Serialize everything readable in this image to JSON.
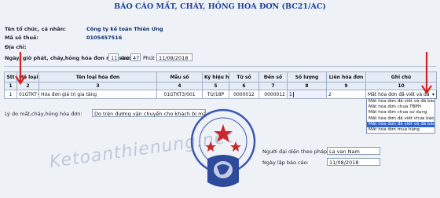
{
  "title": "BÁO CÁO MẤT, CHÁY, HỎNG HÓA ĐƠN (BC21/AC)",
  "org": {
    "name_label": "Tên tổ chức, cá nhân:",
    "name_value": "Công ty kế toán Thiên Ưng",
    "tax_label": "Mã số thuế:",
    "tax_value": "0105457516",
    "addr_label": "Địa chỉ:"
  },
  "incident": {
    "label": "Ngày, giờ phát, cháy,hỏng hóa đơn như sau:",
    "hour": "11",
    "hour_label": "Giờ",
    "minute": "47",
    "minute_label": "Phút",
    "date": "11/08/2018"
  },
  "table": {
    "headers": [
      "Stt",
      "Mã loại hóa đơn",
      "Tên loại hóa đơn",
      "Mẫu số",
      "Ký hiệu hóa đơn",
      "Từ số",
      "Đến số",
      "Số lượng",
      "Liên hóa đơn",
      "Ghi chú"
    ],
    "col_nums": [
      "1",
      "2",
      "3",
      "4",
      "5",
      "6",
      "7",
      "8",
      "9",
      "10"
    ],
    "row": {
      "stt": "1",
      "code": "01GTKT",
      "name": "Hóa đơn giá trị gia tăng",
      "form": "01GTKT3/001",
      "symbol": "TU/18P",
      "from": "0000012",
      "to": "0000012",
      "qty": "1",
      "copy": "2",
      "note": "Mất hóa đơn đã viết và đã báo"
    }
  },
  "dropdown": {
    "options": [
      "Mất hóa đơn đã viết và đã báo cáo",
      "Mất hóa đơn chưa TBPH",
      "Mất hóa đơn chưa sử dụng",
      "Mất hóa đơn đã viết chưa báo cáo",
      "Mất hóa đơn đã viết và đã báo cáo",
      "Mất hóa đơn mua hàng"
    ],
    "selected_index": 4
  },
  "reason": {
    "label": "Lý do mất,cháy,hỏng hóa đơn:",
    "value": "Do trên đường vận chuyển cho khách bị mất"
  },
  "rep": {
    "label": "Người đại diện theo pháp luật:",
    "value": "La van Nam"
  },
  "report_date": {
    "label": "Ngày lập báo cáo:",
    "value": "11/08/2018"
  },
  "seal_text": [
    "CÔNG TY TNHH DỊCH VỤ TƯ VẤN ĐẦU TƯ",
    "KẾ TOÁN THIÊN ƯNG"
  ],
  "watermark": "Ketoanthienung.net",
  "colors": {
    "title": "#1f3f9a",
    "arrow": "#d21f1f",
    "selection": "#2f62c8"
  }
}
